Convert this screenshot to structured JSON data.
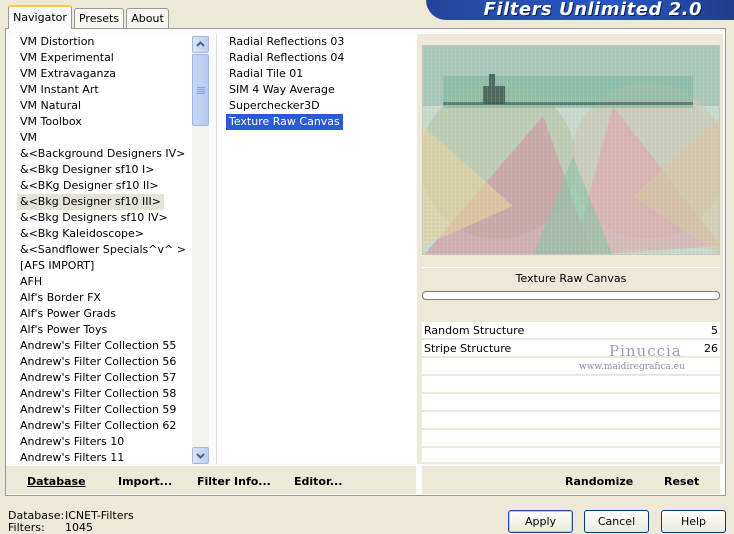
{
  "tabs": [
    "Navigator",
    "Presets",
    "About"
  ],
  "logo": "Filters Unlimited 2.0",
  "categories": [
    "VM Distortion",
    "VM Experimental",
    "VM Extravaganza",
    "VM Instant Art",
    "VM Natural",
    "VM Toolbox",
    "VM",
    "&<Background Designers IV>",
    "&<Bkg Designer sf10 I>",
    "&<BKg Designer sf10 II>",
    "&<Bkg Designer sf10 III>",
    "&<Bkg Designers sf10 IV>",
    "&<Bkg Kaleidoscope>",
    "&<Sandflower Specials^v^ >",
    "[AFS IMPORT]",
    "AFH",
    "Alf's Border FX",
    "Alf's Power Grads",
    "Alf's Power Toys",
    "Andrew's Filter Collection 55",
    "Andrew's Filter Collection 56",
    "Andrew's Filter Collection 57",
    "Andrew's Filter Collection 58",
    "Andrew's Filter Collection 59",
    "Andrew's Filter Collection 62",
    "Andrew's Filters 10",
    "Andrew's Filters 11"
  ],
  "filters": [
    "Radial Reflections 03",
    "Radial Reflections 04",
    "Radial Tile 01",
    "SIM 4 Way Average",
    "Superchecker3D",
    "Texture Raw Canvas"
  ],
  "preview": {
    "filter_name": "Texture Raw Canvas"
  },
  "params": [
    {
      "label": "Random Structure",
      "value": "5"
    },
    {
      "label": "Stripe Structure",
      "value": "26"
    }
  ],
  "watermark": {
    "name": "Pinuccia",
    "url": "www.maidiregrafica.eu"
  },
  "left_buttons": {
    "database": "Database",
    "import": "Import...",
    "filter_info": "Filter Info...",
    "editor": "Editor..."
  },
  "right_buttons": {
    "randomize": "Randomize",
    "reset": "Reset"
  },
  "status": {
    "database_label": "Database:",
    "database_value": "ICNET-Filters",
    "filters_label": "Filters:",
    "filters_value": "1045"
  },
  "dialog_buttons": {
    "apply": "Apply",
    "cancel": "Cancel",
    "help": "Help"
  }
}
